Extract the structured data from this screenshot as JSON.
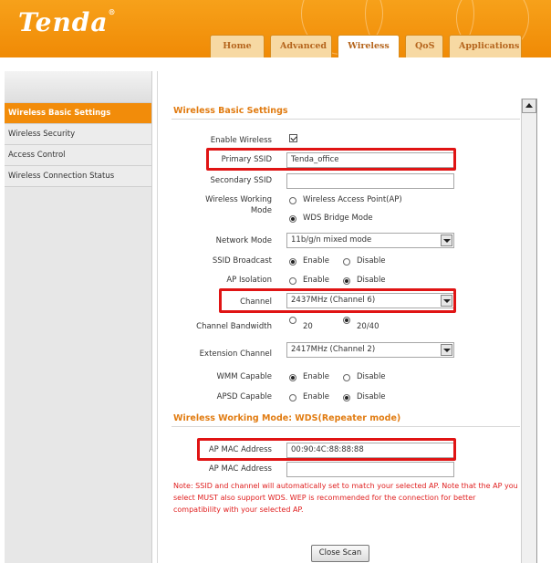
{
  "header": {
    "logo": "Tenda",
    "tabs": [
      {
        "label": "Home"
      },
      {
        "label": "Advanced"
      },
      {
        "label": "Wireless"
      },
      {
        "label": "QoS"
      },
      {
        "label": "Applications"
      }
    ],
    "active_tab": "Wireless"
  },
  "sidebar": {
    "items": [
      {
        "label": "Wireless Basic Settings"
      },
      {
        "label": "Wireless Security"
      },
      {
        "label": "Access Control"
      },
      {
        "label": "Wireless Connection Status"
      }
    ],
    "active_item": "Wireless Basic Settings"
  },
  "main": {
    "section_title": "Wireless Basic Settings",
    "enable_wireless": {
      "label": "Enable Wireless",
      "checked": true
    },
    "primary_ssid": {
      "label": "Primary SSID",
      "value": "Tenda_office"
    },
    "secondary_ssid": {
      "label": "Secondary SSID",
      "value": ""
    },
    "working_mode": {
      "label_line1": "Wireless Working",
      "label_line2": "Mode",
      "options": [
        "Wireless Access Point(AP)",
        "WDS Bridge Mode"
      ],
      "selected": "WDS Bridge Mode"
    },
    "network_mode": {
      "label": "Network Mode",
      "value": "11b/g/n mixed mode"
    },
    "ssid_broadcast": {
      "label": "SSID Broadcast",
      "options": [
        "Enable",
        "Disable"
      ],
      "selected": "Enable"
    },
    "ap_isolation": {
      "label": "AP Isolation",
      "options": [
        "Enable",
        "Disable"
      ],
      "selected": "Disable"
    },
    "channel": {
      "label": "Channel",
      "value": "2437MHz (Channel 6)"
    },
    "channel_bandwidth": {
      "label": "Channel Bandwidth",
      "options": [
        "20",
        "20/40"
      ],
      "selected": "20/40"
    },
    "extension_channel": {
      "label": "Extension Channel",
      "value": "2417MHz (Channel 2)"
    },
    "wmm_capable": {
      "label": "WMM Capable",
      "options": [
        "Enable",
        "Disable"
      ],
      "selected": "Enable"
    },
    "apsd_capable": {
      "label": "APSD Capable",
      "options": [
        "Enable",
        "Disable"
      ],
      "selected": "Disable"
    },
    "wds_section_title": "Wireless Working Mode: WDS(Repeater mode)",
    "ap_mac_1": {
      "label": "AP MAC Address",
      "value": "00:90:4C:88:88:88"
    },
    "ap_mac_2": {
      "label": "AP MAC Address",
      "value": ""
    },
    "note": "Note: SSID and channel will automatically set to match your selected AP. Note that the AP you select MUST also support WDS. WEP is recommended for the connection for better compatibility with your selected AP.",
    "close_scan_label": "Close Scan"
  },
  "colors": {
    "brand_orange": "#f28c0a",
    "highlight_red": "#e01414",
    "note_red": "#e02020",
    "section_title": "#e17c12"
  },
  "icons": [
    "checkbox-checked-icon",
    "radio-selected-icon",
    "radio-unselected-icon",
    "dropdown-arrow-icon",
    "scroll-up-arrow-icon"
  ]
}
